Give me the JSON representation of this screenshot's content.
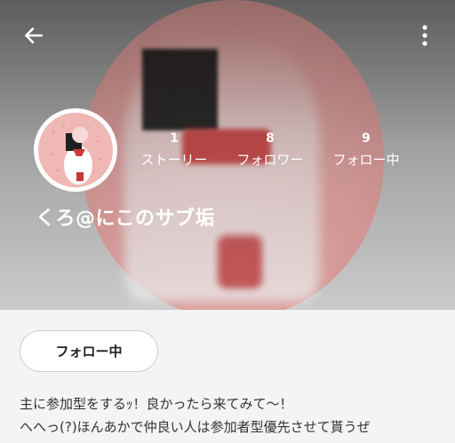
{
  "profile": {
    "name": "くろ@にこのサブ垢"
  },
  "stats": [
    {
      "value": "1",
      "label": "ストーリー"
    },
    {
      "value": "8",
      "label": "フォロワー"
    },
    {
      "value": "9",
      "label": "フォロー中"
    }
  ],
  "actions": {
    "follow_label": "フォロー中"
  },
  "bio": {
    "line1": "主に参加型をするｯ！良かったら来てみて～！",
    "line2": "へへっ(?)ほんあかで仲良い人は参加者型優先させて貰うぜ"
  },
  "icons": {
    "back": "arrow-left-icon",
    "menu": "more-vertical-icon"
  },
  "colors": {
    "accent_white": "#ffffff",
    "text_dark": "#333333",
    "content_bg": "#f4f4f4"
  }
}
